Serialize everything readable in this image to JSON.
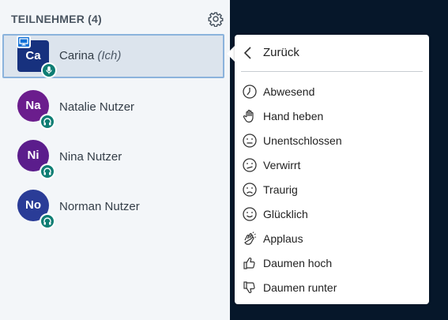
{
  "sidebar": {
    "title": "TEILNEHMER (4)",
    "users": [
      {
        "initials": "Ca",
        "name": "Carina",
        "suffix": " (Ich)",
        "color": "#17317e",
        "selected": true,
        "presenter": true,
        "audio": "microphone-icon"
      },
      {
        "initials": "Na",
        "name": "Natalie Nutzer",
        "suffix": "",
        "color": "#6b1d8d",
        "selected": false,
        "presenter": false,
        "audio": "headphones-icon"
      },
      {
        "initials": "Ni",
        "name": "Nina Nutzer",
        "suffix": "",
        "color": "#5b1d8c",
        "selected": false,
        "presenter": false,
        "audio": "headphones-icon"
      },
      {
        "initials": "No",
        "name": "Norman Nutzer",
        "suffix": "",
        "color": "#2a3c97",
        "selected": false,
        "presenter": false,
        "audio": "headphones-icon"
      }
    ]
  },
  "status_menu": {
    "back_label": "Zurück",
    "items": [
      {
        "label": "Abwesend",
        "icon": "clock-icon"
      },
      {
        "label": "Hand heben",
        "icon": "hand-icon"
      },
      {
        "label": "Unentschlossen",
        "icon": "neutral-face-icon"
      },
      {
        "label": "Verwirrt",
        "icon": "confused-face-icon"
      },
      {
        "label": "Traurig",
        "icon": "sad-face-icon"
      },
      {
        "label": "Glücklich",
        "icon": "happy-face-icon"
      },
      {
        "label": "Applaus",
        "icon": "applause-icon"
      },
      {
        "label": "Daumen hoch",
        "icon": "thumbs-up-icon"
      },
      {
        "label": "Daumen runter",
        "icon": "thumbs-down-icon"
      }
    ]
  }
}
